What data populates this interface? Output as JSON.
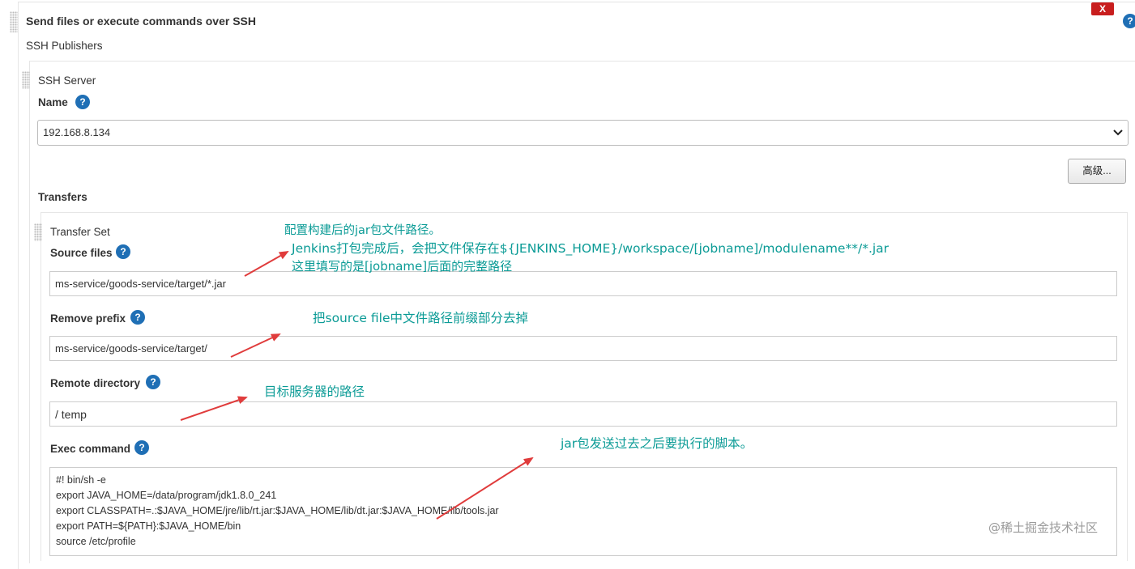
{
  "header": {
    "title": "Send files or execute commands over SSH",
    "close_label": "X"
  },
  "ssh_publishers": {
    "label": "SSH Publishers"
  },
  "ssh_server": {
    "label": "SSH Server",
    "name_label": "Name",
    "name_value": "192.168.8.134",
    "advanced_label": "高级..."
  },
  "transfers": {
    "label": "Transfers"
  },
  "transfer_set": {
    "label": "Transfer Set",
    "source_files_label": "Source files",
    "source_files_value": "ms-service/goods-service/target/*.jar",
    "remove_prefix_label": "Remove prefix",
    "remove_prefix_value": "ms-service/goods-service/target/",
    "remote_directory_label": "Remote directory",
    "remote_directory_value": "/ temp",
    "exec_command_label": "Exec command",
    "exec_command_lines": [
      "#! bin/sh -e",
      "export JAVA_HOME=/data/program/jdk1.8.0_241",
      "export CLASSPATH=.:$JAVA_HOME/jre/lib/rt.jar:$JAVA_HOME/lib/dt.jar:$JAVA_HOME/lib/tools.jar",
      "export PATH=${PATH}:$JAVA_HOME/bin",
      "source /etc/profile"
    ]
  },
  "annotations": {
    "source_line1": "配置构建后的jar包文件路径。",
    "source_line2": "Jenkins打包完成后，会把文件保存在${JENKINS_HOME}/workspace/[jobname]/modulename**/*.jar",
    "source_line3": "这里填写的是[jobname]后面的完整路径",
    "remove_prefix": "把source file中文件路径前缀部分去掉",
    "remote_directory": "目标服务器的路径",
    "exec_command": "jar包发送过去之后要执行的脚本。"
  },
  "help_icon": "?",
  "watermark": "@稀土掘金技术社区",
  "colors": {
    "annotation": "#0b9b96",
    "arrow": "#e03c3c",
    "help": "#1f6fb5",
    "close": "#c81e1e"
  }
}
